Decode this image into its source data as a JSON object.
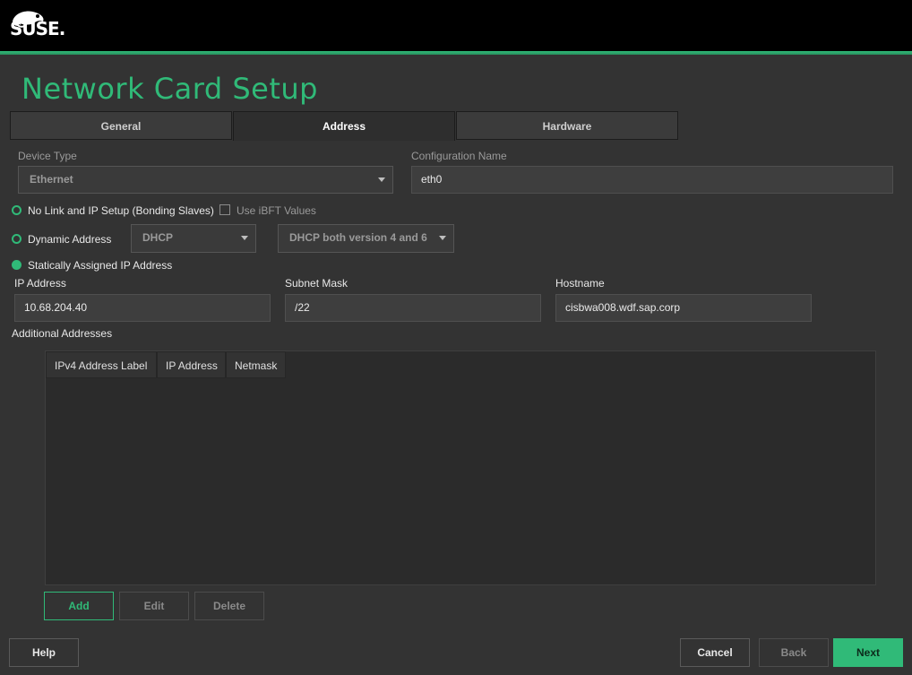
{
  "brand": {
    "logo_text": "SUSE."
  },
  "page_title": "Network Card Setup",
  "tabs": [
    {
      "label": "General",
      "active": false
    },
    {
      "label": "Address",
      "active": true
    },
    {
      "label": "Hardware",
      "active": false
    }
  ],
  "device_type": {
    "label": "Device Type",
    "value": "Ethernet"
  },
  "configuration_name": {
    "label": "Configuration Name",
    "value": "eth0"
  },
  "options": {
    "no_link": {
      "label": "No Link and IP Setup (Bonding Slaves)",
      "selected": false
    },
    "use_ibft": {
      "label": "Use iBFT Values",
      "checked": false
    },
    "dynamic": {
      "label": "Dynamic Address",
      "selected": false,
      "mode": "DHCP",
      "version": "DHCP both version 4 and 6"
    },
    "static": {
      "label": "Statically Assigned IP Address",
      "selected": true
    }
  },
  "ip_address": {
    "label": "IP Address",
    "value": "10.68.204.40"
  },
  "subnet_mask": {
    "label": "Subnet Mask",
    "value": "/22"
  },
  "hostname": {
    "label": "Hostname",
    "value": "cisbwa008.wdf.sap.corp"
  },
  "additional": {
    "label": "Additional Addresses",
    "columns": [
      "IPv4 Address Label",
      "IP Address",
      "Netmask"
    ],
    "rows": []
  },
  "table_buttons": {
    "add": "Add",
    "edit": "Edit",
    "delete": "Delete"
  },
  "footer": {
    "help": "Help",
    "cancel": "Cancel",
    "back": "Back",
    "next": "Next"
  },
  "colors": {
    "accent": "#30ba78",
    "background": "#333333",
    "header": "#000000"
  }
}
